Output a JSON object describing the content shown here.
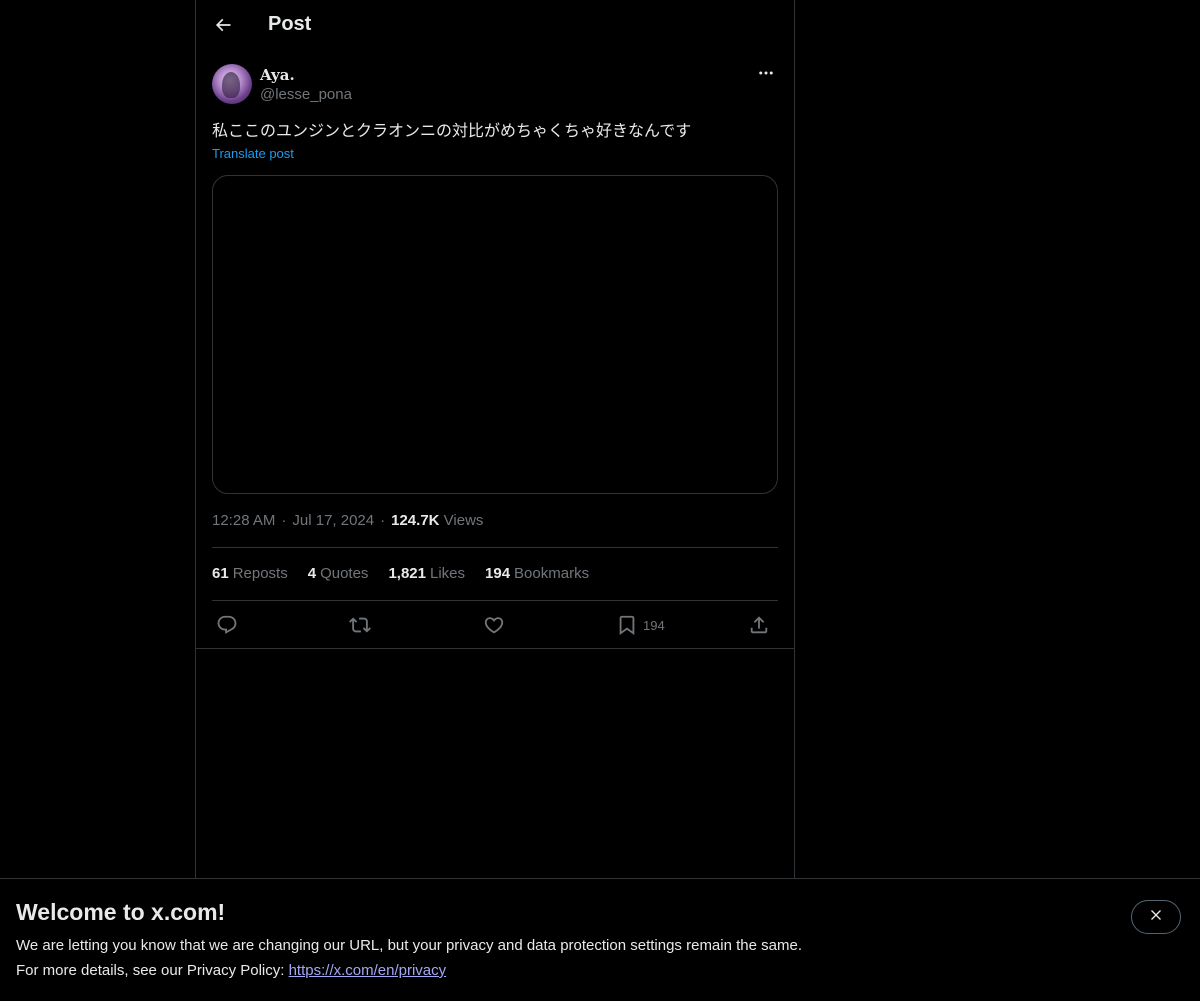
{
  "header": {
    "title": "Post",
    "back_icon": "arrow-left-icon"
  },
  "author": {
    "display_name": "Aya.",
    "handle": "@lesse_pona"
  },
  "tweet": {
    "text": "私ここのユンジンとクラオンニの対比がめちゃくちゃ好きなんです",
    "translate_label": "Translate post"
  },
  "meta": {
    "time": "12:28 AM",
    "separator": "·",
    "date": "Jul 17, 2024",
    "views_count": "124.7K",
    "views_label": "Views"
  },
  "stats": {
    "reposts_count": "61",
    "reposts_label": "Reposts",
    "quotes_count": "4",
    "quotes_label": "Quotes",
    "likes_count": "1,821",
    "likes_label": "Likes",
    "bookmarks_count": "194",
    "bookmarks_label": "Bookmarks"
  },
  "actions": {
    "reply_icon": "reply-icon",
    "repost_icon": "repost-icon",
    "like_icon": "heart-icon",
    "bookmark_icon": "bookmark-icon",
    "bookmark_count": "194",
    "share_icon": "share-icon"
  },
  "banner": {
    "title": "Welcome to x.com!",
    "line1": "We are letting you know that we are changing our URL, but your privacy and data protection settings remain the same.",
    "line2_prefix": "For more details, see our Privacy Policy: ",
    "link_text": "https://x.com/en/privacy"
  },
  "colors": {
    "background": "#000000",
    "text_primary": "#e7e9ea",
    "text_secondary": "#71767b",
    "accent": "#1d9bf0",
    "border": "#2f3336",
    "link": "#a3a7f5"
  }
}
